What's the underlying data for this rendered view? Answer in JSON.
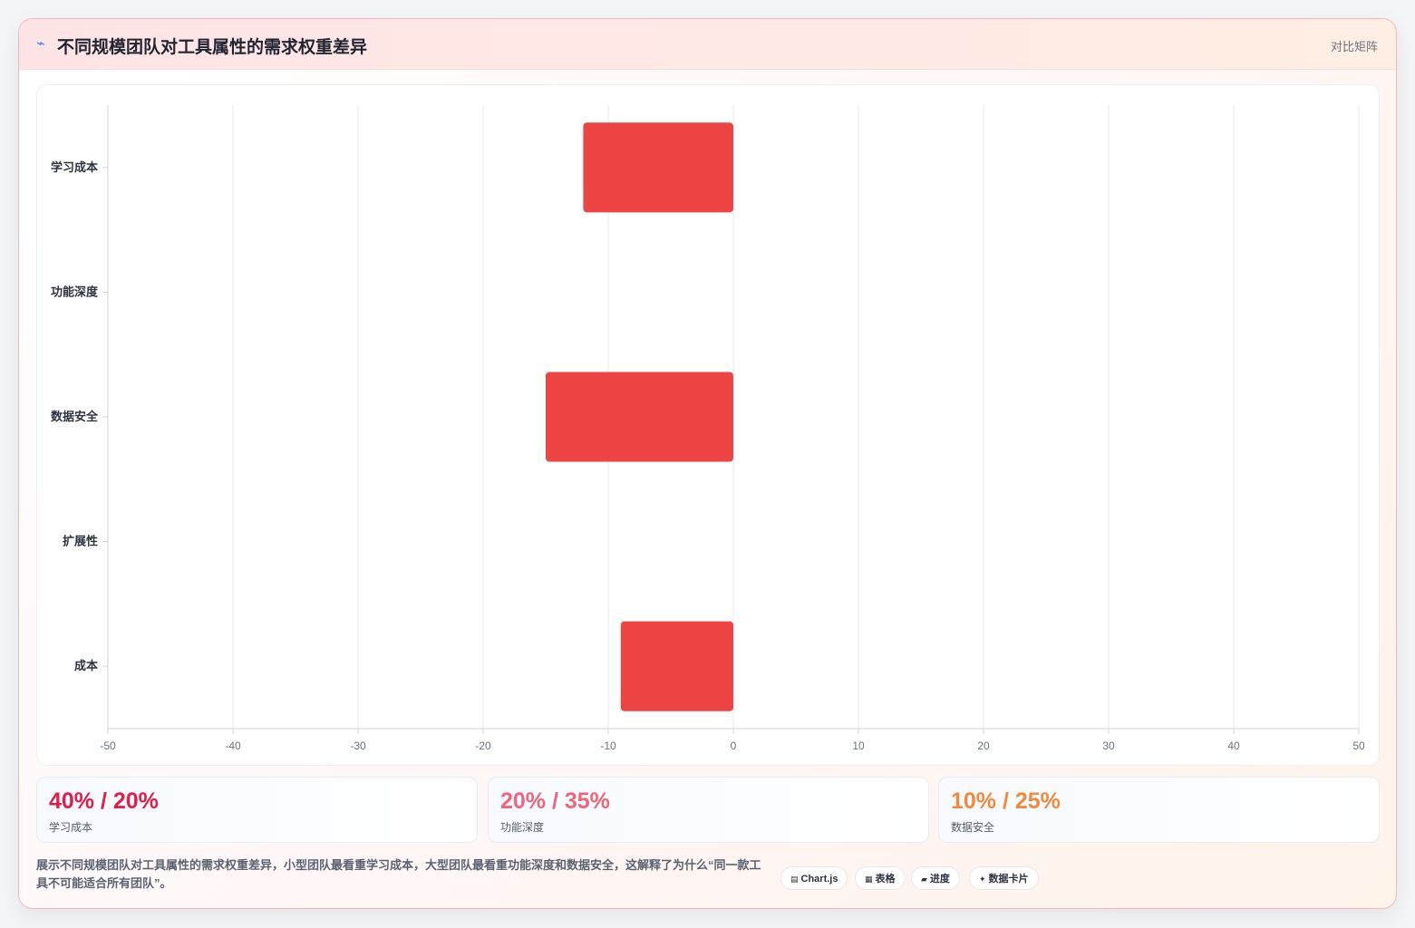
{
  "header": {
    "icon": "chart-icon",
    "title": "不同规模团队对工具属性的需求权重差异",
    "badge": "对比矩阵"
  },
  "chart_data": {
    "type": "bar",
    "orientation": "horizontal",
    "categories": [
      "学习成本",
      "功能深度",
      "数据安全",
      "扩展性",
      "成本"
    ],
    "values": [
      -12,
      0,
      -15,
      0,
      -9
    ],
    "xlim": [
      -50,
      50
    ],
    "xticks": [
      "-50",
      "-40",
      "-30",
      "-20",
      "-10",
      "0",
      "10",
      "20",
      "30",
      "40",
      "50"
    ],
    "bar_color": "#ef4444",
    "grid": true
  },
  "stats": [
    {
      "value": "40% / 20%",
      "label": "学习成本",
      "color": "#e11d48"
    },
    {
      "value": "20% / 35%",
      "label": "功能深度",
      "color": "#f0657a"
    },
    {
      "value": "10% / 25%",
      "label": "数据安全",
      "color": "#f08a3c"
    }
  ],
  "footnote": "展示不同规模团队对工具属性的需求权重差异，小型团队最看重学习成本，大型团队最看重功能深度和数据安全，这解释了为什么“同一款工具不可能适合所有团队”。",
  "pills": [
    {
      "icon": "chart-icon",
      "glyph": "▤",
      "label": "Chart.js"
    },
    {
      "icon": "table-icon",
      "glyph": "▦",
      "label": "表格"
    },
    {
      "icon": "progress-icon",
      "glyph": "▰",
      "label": "进度"
    },
    {
      "icon": "sparkle-icon",
      "glyph": "✦",
      "label": "数据卡片"
    }
  ]
}
